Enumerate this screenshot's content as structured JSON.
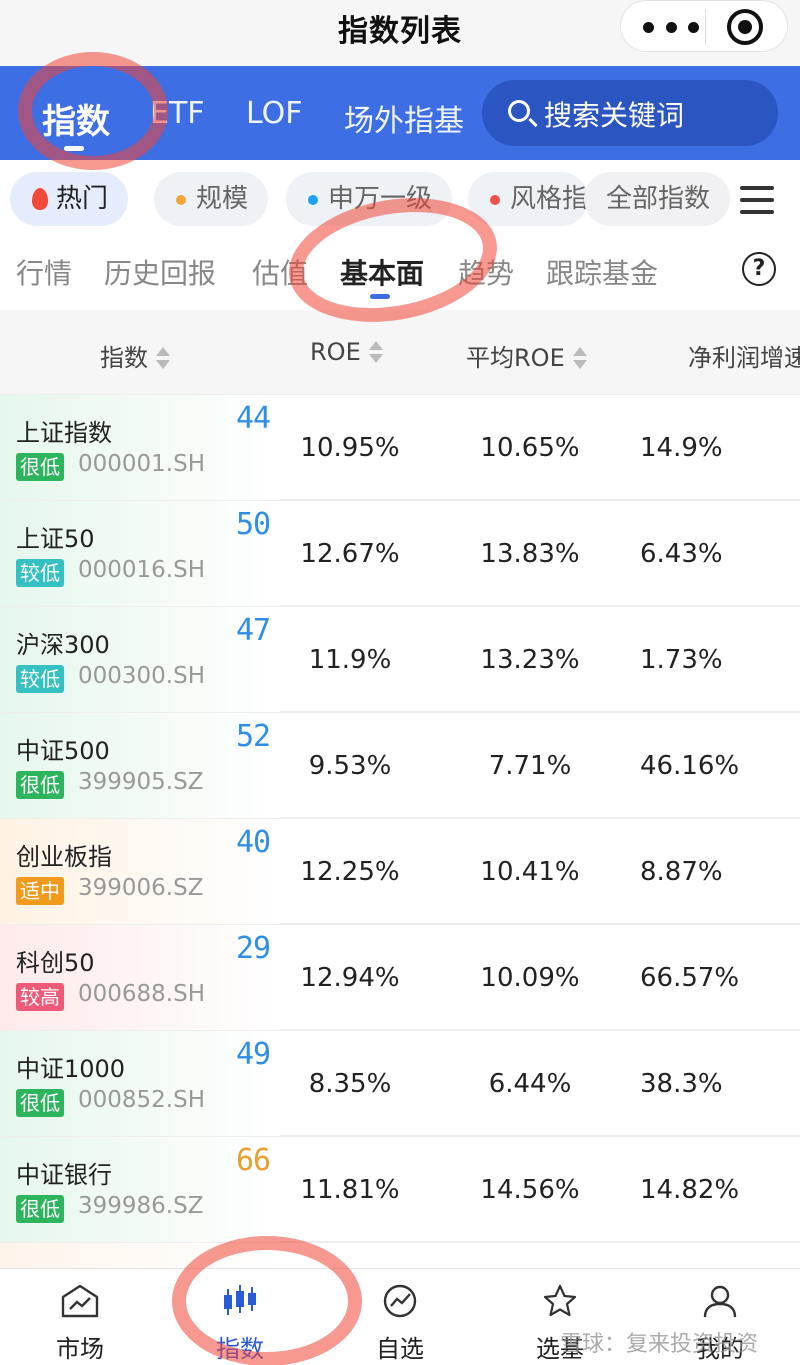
{
  "titlebar": {
    "title": "指数列表"
  },
  "top_tabs": [
    {
      "label": "指数",
      "active": true
    },
    {
      "label": "ETF"
    },
    {
      "label": "LOF"
    },
    {
      "label": "场外指基"
    }
  ],
  "search": {
    "placeholder": "搜索关键词"
  },
  "chips": [
    {
      "label": "热门",
      "active": true,
      "icon": "flame-icon"
    },
    {
      "label": "规模",
      "dot_color": "#f0a63a"
    },
    {
      "label": "申万一级",
      "dot_color": "#1da1f2"
    },
    {
      "label": "风格指",
      "dot_color": "#f0504a"
    },
    {
      "label": "全部指数"
    }
  ],
  "sub_tabs": [
    {
      "label": "行情"
    },
    {
      "label": "历史回报"
    },
    {
      "label": "估值"
    },
    {
      "label": "基本面",
      "active": true
    },
    {
      "label": "趋势"
    },
    {
      "label": "跟踪基金"
    }
  ],
  "help": {
    "label": "?"
  },
  "columns": [
    "指数",
    "ROE",
    "平均ROE",
    "净利润增速"
  ],
  "rows": [
    {
      "name": "上证指数",
      "badge": "很低",
      "code": "000001.SH",
      "score": "44",
      "roe": "10.95%",
      "avg_roe": "10.65%",
      "growth": "14.9%"
    },
    {
      "name": "上证50",
      "badge": "较低",
      "code": "000016.SH",
      "score": "50",
      "roe": "12.67%",
      "avg_roe": "13.83%",
      "growth": "6.43%"
    },
    {
      "name": "沪深300",
      "badge": "较低",
      "code": "000300.SH",
      "score": "47",
      "roe": "11.9%",
      "avg_roe": "13.23%",
      "growth": "1.73%"
    },
    {
      "name": "中证500",
      "badge": "很低",
      "code": "399905.SZ",
      "score": "52",
      "roe": "9.53%",
      "avg_roe": "7.71%",
      "growth": "46.16%"
    },
    {
      "name": "创业板指",
      "badge": "适中",
      "code": "399006.SZ",
      "score": "40",
      "roe": "12.25%",
      "avg_roe": "10.41%",
      "growth": "8.87%"
    },
    {
      "name": "科创50",
      "badge": "较高",
      "code": "000688.SH",
      "score": "29",
      "roe": "12.94%",
      "avg_roe": "10.09%",
      "growth": "66.57%"
    },
    {
      "name": "中证1000",
      "badge": "很低",
      "code": "000852.SH",
      "score": "49",
      "roe": "8.35%",
      "avg_roe": "6.44%",
      "growth": "38.3%"
    },
    {
      "name": "中证银行",
      "badge": "很低",
      "code": "399986.SZ",
      "score": "66",
      "roe": "11.81%",
      "avg_roe": "14.56%",
      "growth": "14.82%"
    }
  ],
  "badge_colors": {
    "很低": "#2db55d",
    "较低": "#35c1c1",
    "适中": "#f29a1c",
    "较高": "#ef5a78"
  },
  "score_colors": {
    "blue": "#2f8fe8",
    "orange": "#e8a030"
  },
  "bottom_nav": [
    {
      "label": "市场",
      "icon": "market-icon"
    },
    {
      "label": "指数",
      "icon": "candlestick-icon",
      "active": true
    },
    {
      "label": "自选",
      "icon": "watchlist-icon"
    },
    {
      "label": "选基",
      "icon": "star-fund-icon"
    },
    {
      "label": "我的",
      "icon": "user-icon"
    }
  ],
  "watermark": "雪球：复来投资投资"
}
